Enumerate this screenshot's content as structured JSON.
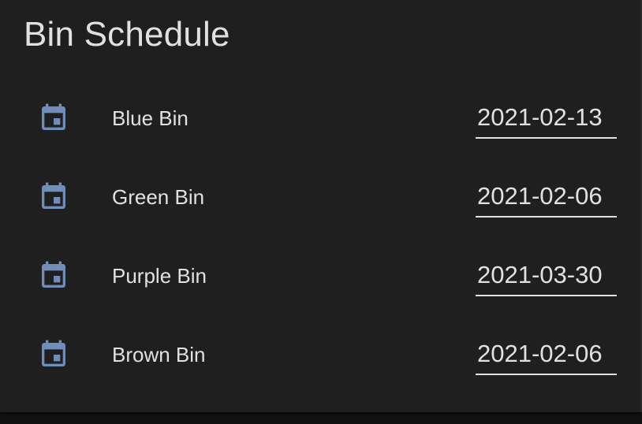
{
  "card": {
    "title": "Bin Schedule"
  },
  "colors": {
    "card_background": "#1f1f1f",
    "text": "#e1e1e1",
    "icon": "#6f8db6",
    "underline": "#e1e1e1"
  },
  "rows": [
    {
      "icon": "calendar-icon",
      "label": "Blue Bin",
      "date": "2021-02-13"
    },
    {
      "icon": "calendar-icon",
      "label": "Green Bin",
      "date": "2021-02-06"
    },
    {
      "icon": "calendar-icon",
      "label": "Purple Bin",
      "date": "2021-03-30"
    },
    {
      "icon": "calendar-icon",
      "label": "Brown Bin",
      "date": "2021-02-06"
    }
  ]
}
